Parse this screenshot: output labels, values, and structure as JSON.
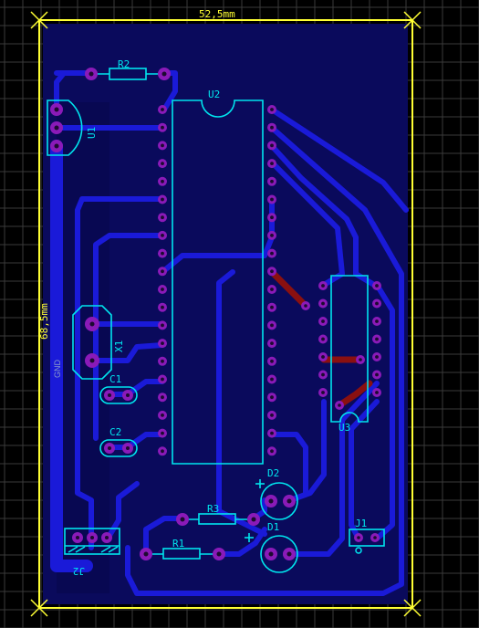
{
  "board": {
    "width_label": "52,5mm",
    "height_label": "68,5mm",
    "gnd_label": "GND"
  },
  "components": {
    "R1": "R1",
    "R2": "R2",
    "R3": "R3",
    "U1": "U1",
    "U2": "U2",
    "U3": "U3",
    "X1": "X1",
    "C1": "C1",
    "C2": "C2",
    "D1": "D1",
    "D2": "D2",
    "J1": "J1",
    "J2": "J2"
  },
  "colors": {
    "background": "#000000",
    "grid": "#3a3a3a",
    "outline": "#ffff33",
    "silkscreen": "#00e5ee",
    "bottom_copper": "#1a1ad8",
    "top_copper": "#8a1010",
    "pad": "#8a1ab8"
  }
}
